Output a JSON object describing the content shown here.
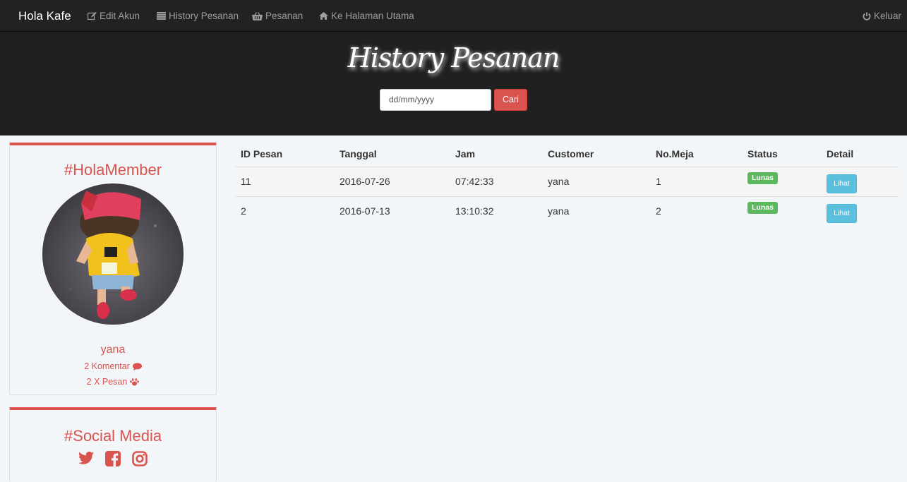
{
  "navbar": {
    "brand": "Hola Kafe",
    "items": [
      {
        "label": "Edit Akun",
        "icon": "edit-icon"
      },
      {
        "label": "History Pesanan",
        "icon": "list-icon"
      },
      {
        "label": "Pesanan",
        "icon": "basket-icon"
      },
      {
        "label": "Ke Halaman Utama",
        "icon": "home-icon"
      }
    ],
    "logout": {
      "label": "Keluar",
      "icon": "power-icon"
    }
  },
  "header": {
    "title": "History Pesanan",
    "date_placeholder": "dd/mm/yyyy",
    "search_label": "Cari"
  },
  "member": {
    "heading": "#HolaMember",
    "username": "yana",
    "comments": "2 Komentar",
    "orders": "2 X Pesan"
  },
  "social": {
    "heading": "#Social Media",
    "icons": [
      "twitter-icon",
      "facebook-icon",
      "instagram-icon"
    ]
  },
  "table": {
    "headers": [
      "ID Pesan",
      "Tanggal",
      "Jam",
      "Customer",
      "No.Meja",
      "Status",
      "Detail"
    ],
    "rows": [
      {
        "id": "11",
        "tanggal": "2016-07-26",
        "jam": "07:42:33",
        "customer": "yana",
        "meja": "1",
        "status": "Lunas",
        "detail": "Lihat"
      },
      {
        "id": "2",
        "tanggal": "2016-07-13",
        "jam": "13:10:32",
        "customer": "yana",
        "meja": "2",
        "status": "Lunas",
        "detail": "Lihat"
      }
    ]
  },
  "colors": {
    "accent": "#d9534f",
    "success": "#5cb85c",
    "info": "#5bc0de",
    "navbar": "#222222"
  }
}
